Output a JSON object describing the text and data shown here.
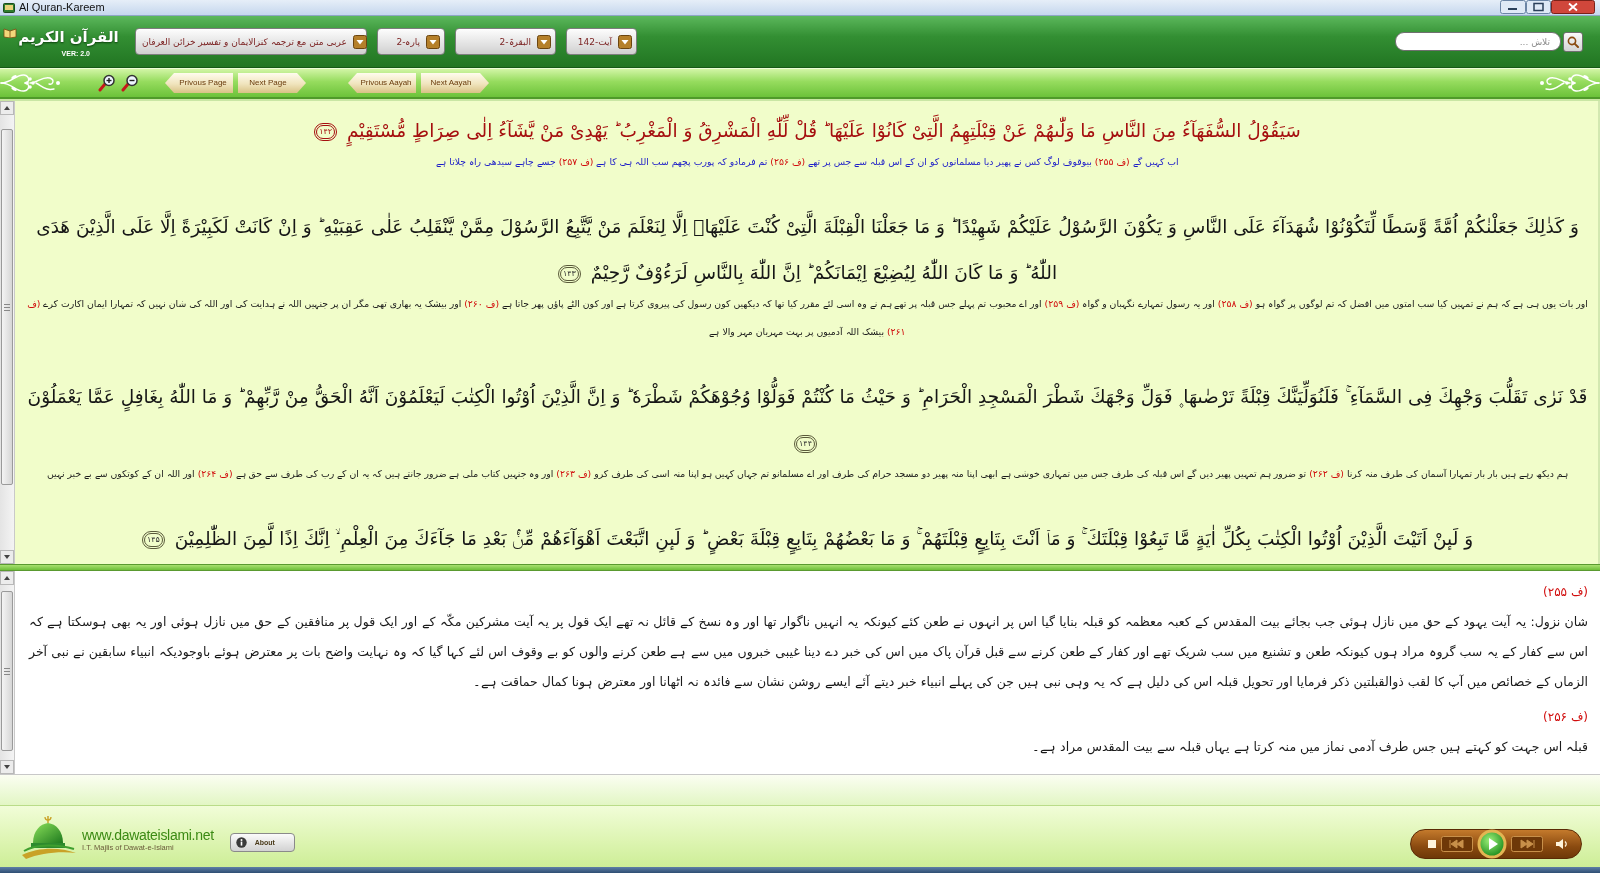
{
  "window": {
    "title": "Al Quran-Kareem"
  },
  "header": {
    "logo": {
      "title": "القرآن الكريم",
      "version": "VER: 2.0"
    },
    "dropdowns": [
      {
        "kind": "ayah",
        "value": "آیت-142"
      },
      {
        "kind": "surah",
        "value": "البقرۃ-2"
      },
      {
        "kind": "para",
        "value": "پارہ-2"
      },
      {
        "kind": "edition",
        "value": "عربی متن مع ترجمہ کنزالایمان و تفسیر خزائن العرفان"
      }
    ],
    "search": {
      "placeholder": "تلاش ..."
    }
  },
  "toolbar": {
    "buttons": [
      {
        "kind": "next",
        "label": "Next Aayah"
      },
      {
        "kind": "prev",
        "label": "Privous Aayah"
      },
      {
        "kind": "next",
        "label": "Next Page"
      },
      {
        "kind": "prev",
        "label": "Privous Page"
      }
    ]
  },
  "verses": [
    {
      "selected": true,
      "arabic": "سَیَقُوْلُ السُّفَهَآءُ مِنَ النَّاسِ مَا وَلّٰىهُمْ عَنْ قِبْلَتِهِمُ الَّتِیْ كَانُوْا عَلَیْهَا ؕ قُلْ لِّلّٰهِ الْمَشْرِقُ وَ الْمَغْرِبُ ؕ یَهْدِیْ مَنْ یَّشَآءُ اِلٰى صِرَاطٍ مُّسْتَقِیْمٍ",
      "number": "۱۴۲",
      "translation": [
        {
          "kind": "text",
          "text": "اب کہیں گے"
        },
        {
          "kind": "footnote",
          "text": "(ف ۲۵۵)"
        },
        {
          "kind": "text",
          "text": "بیوقوف لوگ کس نے پھیر دیا مسلمانوں کو ان کے اس قبلہ سے جس پر تھے"
        },
        {
          "kind": "footnote",
          "text": "(ف ۲۵۶)"
        },
        {
          "kind": "text",
          "text": "تم فرمادو کہ پورب پچھم سب اللہ ہی کا ہے"
        },
        {
          "kind": "footnote",
          "text": "(ف ۲۵۷)"
        },
        {
          "kind": "text",
          "text": "جسے چاہے سیدھی راہ چلاتا ہے"
        }
      ]
    },
    {
      "selected": false,
      "arabic": "وَ كَذٰلِكَ جَعَلْنٰكُمْ اُمَّةً وَّسَطًا لِّتَكُوْنُوْا شُهَدَآءَ عَلَى النَّاسِ وَ یَكُوْنَ الرَّسُوْلُ عَلَیْكُمْ شَهِیْدًا ؕ وَ مَا جَعَلْنَا الْقِبْلَةَ الَّتِیْ كُنْتَ عَلَیْهَاۤ اِلَّا لِنَعْلَمَ مَنْ یَّتَّبِعُ الرَّسُوْلَ مِمَّنْ یَّنْقَلِبُ عَلٰى عَقِبَیْهِ ؕ وَ اِنْ كَانَتْ لَكَبِیْرَةً اِلَّا عَلَى الَّذِیْنَ هَدَى اللّٰهُ ؕ وَ مَا كَانَ اللّٰهُ لِیُضِیْعَ اِیْمَانَكُمْ ؕ اِنَّ اللّٰهَ بِالنَّاسِ لَرَءُوْفٌ رَّحِیْمٌ",
      "number": "۱۴۳",
      "translation": [
        {
          "kind": "text",
          "text": "اور بات یوں ہی ہے کہ ہم نے تمہیں کیا سب امتوں میں افضل کہ تم لوگوں پر گواہ ہو"
        },
        {
          "kind": "footnote",
          "text": "(ف ۲۵۸)"
        },
        {
          "kind": "text",
          "text": "اور یہ رسول تمہارے نگہبان و گواہ"
        },
        {
          "kind": "footnote",
          "text": "(ف ۲۵۹)"
        },
        {
          "kind": "text",
          "text": "اور اے محبوب تم پہلے جس قبلہ پر تھے ہم نے وہ اسی لئے مقرر کیا تھا کہ دیکھیں کون رسول کی پیروی کرتا ہے اور کون الٹے پاؤں پھر جاتا ہے"
        },
        {
          "kind": "footnote",
          "text": "(ف ۲۶۰)"
        },
        {
          "kind": "text",
          "text": "اور بیشک یہ بھاری تھی مگر ان پر جنہیں اللہ نے ہدایت کی اور اللہ کی شان نہیں کہ تمہارا ایمان اکارت کرے"
        },
        {
          "kind": "footnote",
          "text": "(ف ۲۶۱)"
        },
        {
          "kind": "text",
          "text": "بیشک اللہ آدمیوں پر بہت مہربان مہر والا ہے"
        }
      ]
    },
    {
      "selected": false,
      "arabic": "قَدْ نَرٰى تَقَلُّبَ وَجْهِكَ فِی السَّمَآءِ ۚ فَلَنُوَلِّیَنَّكَ قِبْلَةً تَرْضٰىهَا ۪ فَوَلِّ وَجْهَكَ شَطْرَ الْمَسْجِدِ الْحَرَامِ ؕ وَ حَیْثُ مَا كُنْتُمْ فَوَلُّوْا وُجُوْهَكُمْ شَطْرَهٗ ؕ وَ اِنَّ الَّذِیْنَ اُوْتُوا الْكِتٰبَ لَیَعْلَمُوْنَ اَنَّهُ الْحَقُّ مِنْ رَّبِّهِمْ ؕ وَ مَا اللّٰهُ بِغَافِلٍ عَمَّا یَعْمَلُوْنَ",
      "number": "۱۴۴",
      "translation": [
        {
          "kind": "text",
          "text": "ہم دیکھ رہے ہیں بار بار تمہارا آسمان کی طرف منہ کرنا"
        },
        {
          "kind": "footnote",
          "text": "(ف ۲۶۲)"
        },
        {
          "kind": "text",
          "text": "تو ضرور ہم تمہیں پھیر دیں گے اس قبلہ کی طرف جس میں تمہاری خوشی ہے ابھی اپنا منہ پھیر دو مسجد حرام کی طرف اور اے مسلمانو تم جہاں کہیں ہو اپنا منہ اسی کی طرف کرو"
        },
        {
          "kind": "footnote",
          "text": "(ف ۲۶۳)"
        },
        {
          "kind": "text",
          "text": "اور وہ جنہیں کتاب ملی ہے ضرور جانتے ہیں کہ یہ ان کے رب کی طرف سے حق ہے"
        },
        {
          "kind": "footnote",
          "text": "(ف ۲۶۴)"
        },
        {
          "kind": "text",
          "text": "اور اللہ ان کے کوتکوں سے بے خبر نہیں"
        }
      ]
    },
    {
      "selected": false,
      "arabic": "وَ لَىٕنْ اَتَیْتَ الَّذِیْنَ اُوْتُوا الْكِتٰبَ بِكُلِّ اٰیَةٍ مَّا تَبِعُوْا قِبْلَتَكَ ۚ وَ مَاۤ اَنْتَ بِتَابِعٍ قِبْلَتَهُمْ ۚ وَ مَا بَعْضُهُمْ بِتَابِعٍ قِبْلَةَ بَعْضٍ ؕ وَ لَىٕنِ اتَّبَعْتَ اَهْوَآءَهُمْ مِّنْۢ بَعْدِ مَا جَآءَكَ مِنَ الْعِلْمِ ۙ اِنَّكَ اِذًا لَّمِنَ الظّٰلِمِیْنَ",
      "number": "۱۴۵"
    }
  ],
  "commentary": [
    {
      "kind": "heading",
      "text": "(ف ۲۵۵)"
    },
    {
      "kind": "paragraph",
      "text": "شان نزول: یہ آیت یہود کے حق میں نازل ہوئی جب بجائے بیت المقدس کے کعبہ معظمہ کو قبلہ بنایا گیا اس پر انہوں نے طعن کئے کیونکہ یہ انہیں ناگوار تھا اور وہ نسخ کے قائل نہ تھے ایک قول پر یہ آیت مشرکین مکّہ کے اور ایک قول پر منافقین کے حق میں نازل ہوئی اور یہ بھی ہوسکتا ہے کہ اس سے کفار کے یہ سب گروہ مراد ہوں کیونکہ طعن و تشنیع میں سب شریک تھے اور کفار کے طعن کرنے سے قبل قرآن پاک میں اس کی خبر دے دینا غیبی خبروں میں سے ہے طعن کرنے والوں کو بے وقوف اس لئے کہا گیا کہ وہ نہایت واضح بات پر معترض ہوئے باوجودیکہ انبیاء سابقین نے نبی آخر الزماں کے خصائص میں آپ کا لقب ذوالقبلتین ذکر فرمایا اور تحویل قبلہ اس کی دلیل ہے کہ یہ وہی نبی ہیں جن کی پہلے انبیاء خبر دیتے آئے ایسے روشن نشان سے فائدہ نہ اٹھانا اور معترض ہونا کمال حماقت ہے۔"
    },
    {
      "kind": "heading",
      "text": "(ف ۲۵۶)"
    },
    {
      "kind": "paragraph",
      "text": "قبلہ اس جہت کو کہتے ہیں جس طرف آدمی نماز میں منہ کرتا ہے یہاں قبلہ سے بیت المقدس مراد ہے۔"
    }
  ],
  "footer": {
    "site": "www.dawateislami.net",
    "tagline": "I.T. Majlis of Dawat-e-Islami",
    "about_button": "About"
  }
}
